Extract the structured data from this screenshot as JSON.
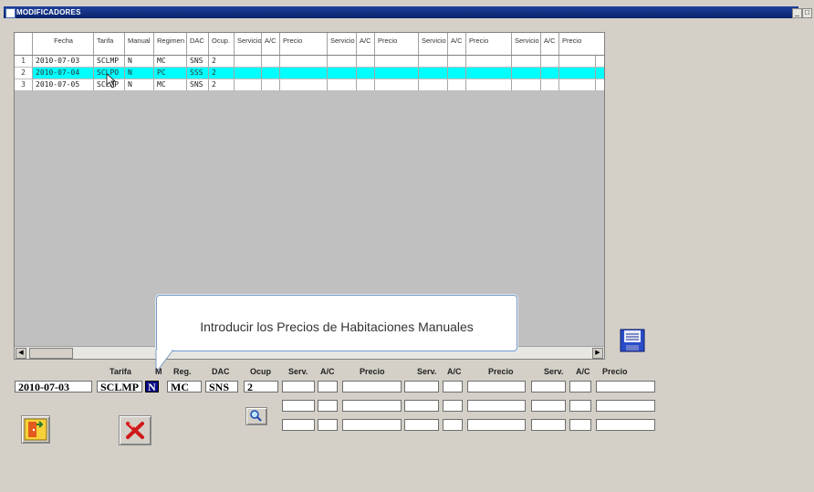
{
  "window": {
    "title": "MODIFICADORES",
    "minimize_glyph": "_",
    "restore_glyph": "□"
  },
  "grid": {
    "headers": [
      "",
      "Fecha",
      "Tarifa",
      "Manual",
      "Regimen",
      "DAC",
      "Ocup.",
      "Servicio",
      "A/C",
      "Precio",
      "Servicio",
      "A/C",
      "Precio",
      "Servicio",
      "A/C",
      "Precio",
      "Servicio",
      "A/C",
      "Precio"
    ],
    "rows": [
      {
        "num": "1",
        "fecha": "2010-07-03",
        "tarifa": "SCLMP",
        "manual": "N",
        "regimen": "MC",
        "dac": "SNS",
        "ocup": "2"
      },
      {
        "num": "2",
        "fecha": "2010-07-04",
        "tarifa": "SCLPO",
        "manual": "N",
        "regimen": "PC",
        "dac": "SSS",
        "ocup": "2"
      },
      {
        "num": "3",
        "fecha": "2010-07-05",
        "tarifa": "SCLMP",
        "manual": "N",
        "regimen": "MC",
        "dac": "SNS",
        "ocup": "2"
      }
    ]
  },
  "tooltip": {
    "text": "Introducir los Precios de Habitaciones Manuales"
  },
  "form": {
    "labels": {
      "tarifa": "Tarifa",
      "manual": "M",
      "reg": "Reg.",
      "dac": "DAC",
      "ocup": "Ocup",
      "serv": "Serv.",
      "ac": "A/C",
      "precio": "Precio"
    },
    "values": {
      "fecha": "2010-07-03",
      "tarifa": "SCLMP",
      "manual": "N",
      "reg": "MC",
      "dac": "SNS",
      "ocup": "2"
    }
  },
  "icons": {
    "save": "floppy-disk-icon",
    "search": "magnifier-icon",
    "exit": "exit-door-icon",
    "cancel": "red-x-icon"
  },
  "colors": {
    "selected_row": "#00ffff",
    "title_bar": "#0a246a",
    "manual_field": "#0a0a88"
  }
}
